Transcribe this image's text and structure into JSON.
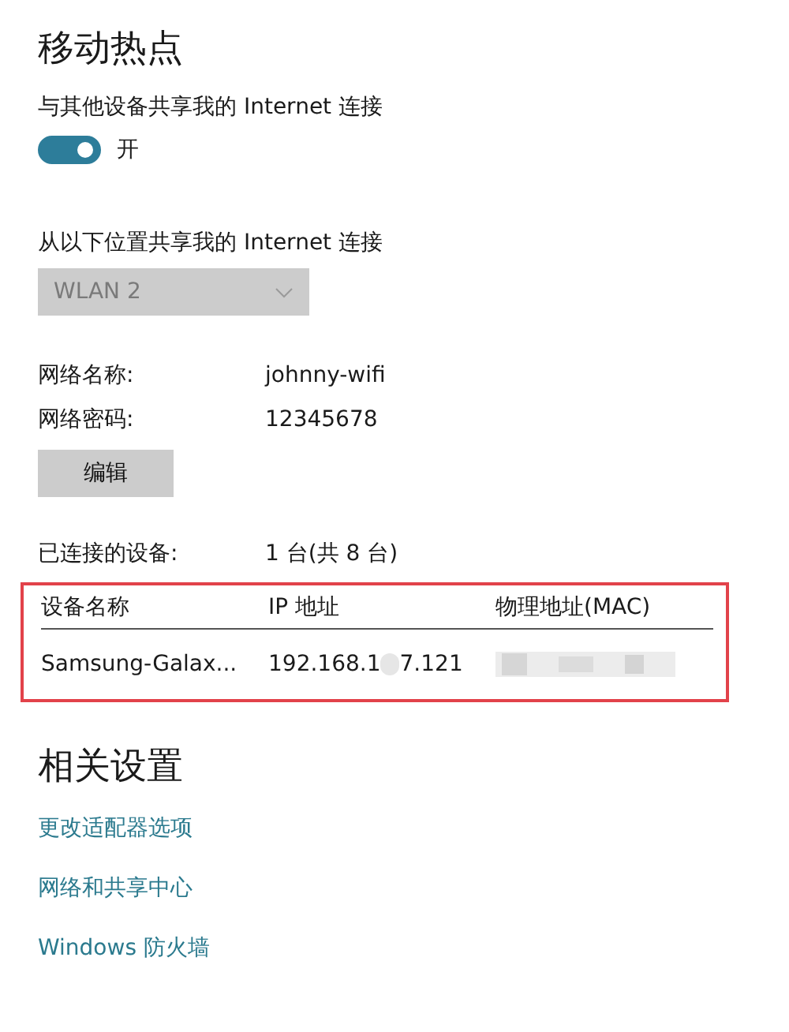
{
  "title": "移动热点",
  "share": {
    "label": "与其他设备共享我的 Internet 连接",
    "toggle": {
      "on": true,
      "label": "开"
    }
  },
  "source": {
    "label": "从以下位置共享我的 Internet 连接",
    "dropdown": {
      "value": "WLAN 2",
      "disabled": true
    }
  },
  "network": [
    {
      "label": "网络名称:",
      "value": "johnny-wifi"
    },
    {
      "label": "网络密码:",
      "value": "12345678"
    }
  ],
  "edit_button": "编辑",
  "connected": {
    "label": "已连接的设备:",
    "value": "1 台(共 8 台)"
  },
  "devices": {
    "highlighted": true,
    "columns": [
      "设备名称",
      "IP 地址",
      "物理地址(MAC)"
    ],
    "rows": [
      {
        "name": "Samsung-Galax...",
        "ip_start": "192.168.1",
        "ip_end": "7.121"
      }
    ]
  },
  "related": {
    "title": "相关设置",
    "links": [
      "更改适配器选项",
      "网络和共享中心",
      "Windows 防火墙"
    ]
  }
}
